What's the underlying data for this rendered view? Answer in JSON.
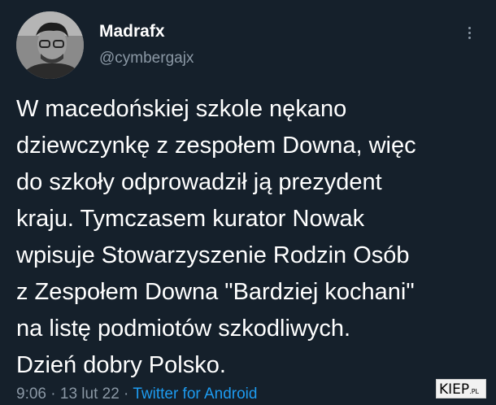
{
  "tweet": {
    "author": {
      "display_name": "Madrafx",
      "handle": "@cymbergajx",
      "avatar_icon": "user-avatar-photo"
    },
    "more_icon": "more-options-icon",
    "text_lines": [
      "W macedońskiej szkole nękano",
      "dziewczynkę z zespołem Downa, więc",
      "do szkoły odprowadził ją prezydent",
      "kraju. Tymczasem kurator Nowak",
      "wpisuje Stowarzyszenie Rodzin Osób",
      "z Zespołem Downa \"Bardziej kochani\"",
      "na listę podmiotów szkodliwych.",
      "Dzień dobry Polsko."
    ],
    "meta": {
      "time": "9:06",
      "separator": " · ",
      "date": "13 lut 22",
      "source": "Twitter for Android"
    }
  },
  "watermark": {
    "text": "KIEP",
    "suffix": ".PL"
  },
  "colors": {
    "background": "#15202b",
    "text": "#ffffff",
    "secondary": "#8b98a5",
    "link": "#1d9bf0"
  }
}
